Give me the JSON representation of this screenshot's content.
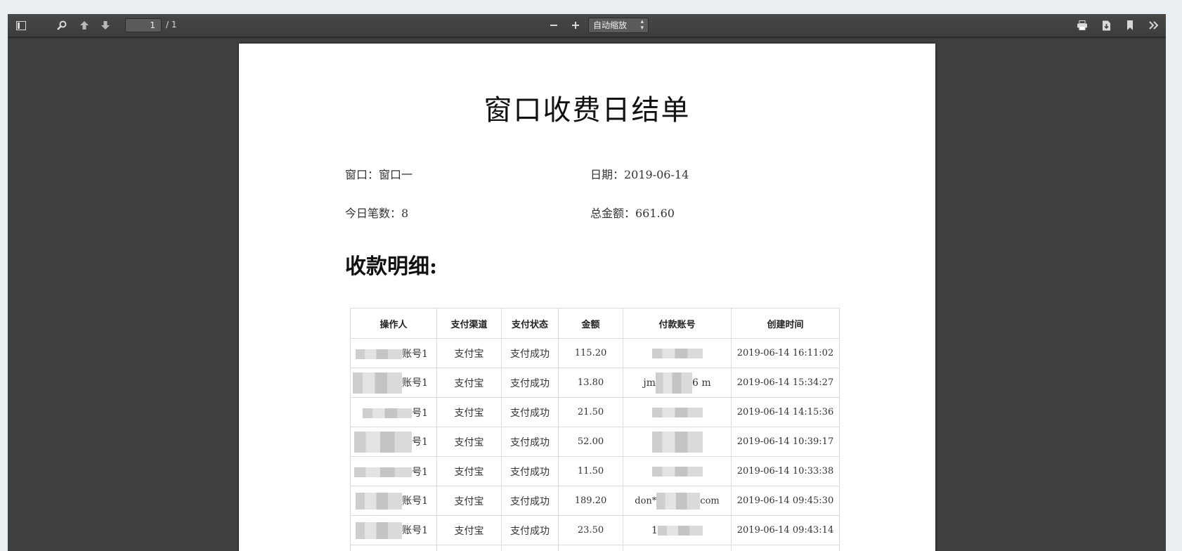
{
  "toolbar": {
    "page_number": "1",
    "page_count": "/ 1",
    "zoom": "自动缩放"
  },
  "document": {
    "title": "窗口收费日结单",
    "window_label": "窗口：窗口一",
    "date_label": "日期：2019-06-14",
    "count_label": "今日笔数：8",
    "total_label": "总金额：661.60",
    "section_title": "收款明细:"
  },
  "table": {
    "headers": [
      "操作人",
      "支付渠道",
      "支付状态",
      "金额",
      "付款账号",
      "创建时间"
    ],
    "rows": [
      {
        "operator": "账号1",
        "channel": "支付宝",
        "status": "支付成功",
        "amount": "115.20",
        "account": "",
        "time": "2019-06-14 16:11:02"
      },
      {
        "operator": "账号1",
        "channel": "支付宝",
        "status": "支付成功",
        "amount": "13.80",
        "account": "jm",
        "account_suffix": "6  m",
        "time": "2019-06-14 15:34:27"
      },
      {
        "operator": "号1",
        "channel": "支付宝",
        "status": "支付成功",
        "amount": "21.50",
        "account": "",
        "time": "2019-06-14 14:15:36"
      },
      {
        "operator": "号1",
        "channel": "支付宝",
        "status": "支付成功",
        "amount": "52.00",
        "account": "",
        "time": "2019-06-14 10:39:17"
      },
      {
        "operator": "号1",
        "channel": "支付宝",
        "status": "支付成功",
        "amount": "11.50",
        "account": "",
        "time": "2019-06-14 10:33:38"
      },
      {
        "operator": "账号1",
        "channel": "支付宝",
        "status": "支付成功",
        "amount": "189.20",
        "account": "don*",
        "account_suffix": "com",
        "time": "2019-06-14 09:45:30"
      },
      {
        "operator": "账号1",
        "channel": "支付宝",
        "status": "支付成功",
        "amount": "23.50",
        "account": "1",
        "time": "2019-06-14 09:43:14"
      }
    ]
  }
}
